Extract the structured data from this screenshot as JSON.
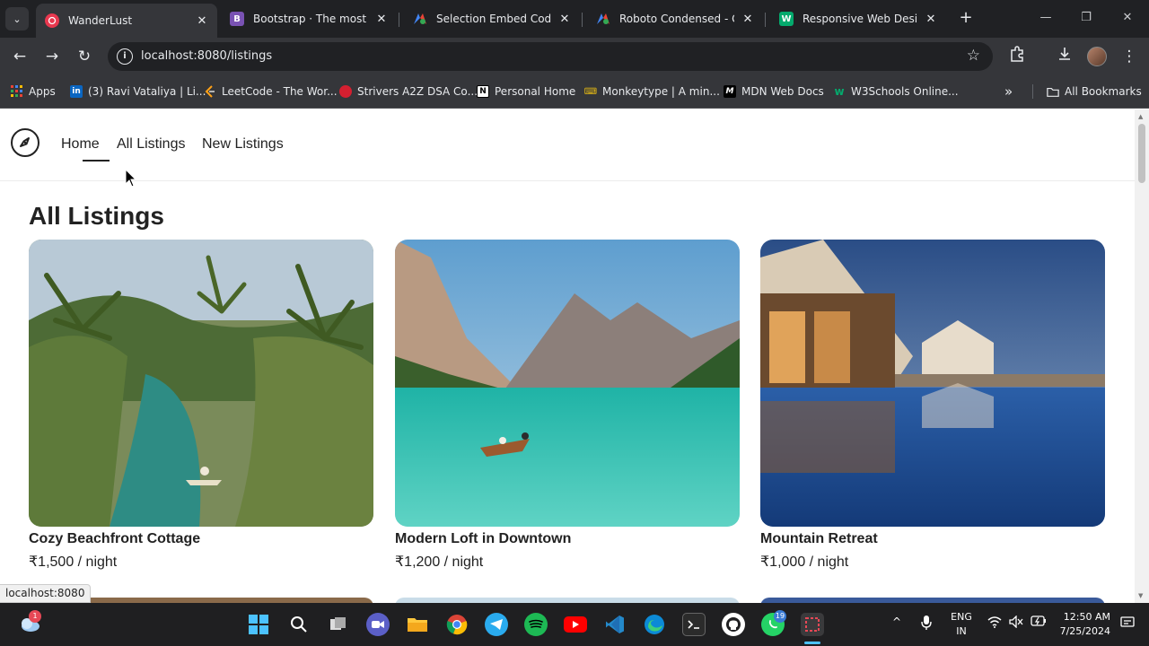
{
  "browser": {
    "tabs": [
      {
        "title": "WanderLust",
        "favicon_color": "#e8384f",
        "active": true
      },
      {
        "title": "Bootstrap · The most pop",
        "favicon_color": "#7952b3",
        "favicon_text": "B",
        "active": false
      },
      {
        "title": "Selection Embed Code - (",
        "favicon_color": "#4285f4",
        "active": false
      },
      {
        "title": "Roboto Condensed - Goo",
        "favicon_color": "#4285f4",
        "active": false
      },
      {
        "title": "Responsive Web Design (",
        "favicon_color": "#04aa6d",
        "favicon_text": "W",
        "active": false
      }
    ],
    "url": "localhost:8080/listings",
    "bookmarks": [
      {
        "label": "Apps",
        "icon": "apps-grid-icon",
        "color": "#4285f4"
      },
      {
        "label": "(3) Ravi Vataliya | Li...",
        "icon": "linkedin-icon",
        "color": "#0a66c2",
        "text": "in"
      },
      {
        "label": "LeetCode - The Wor...",
        "icon": "leetcode-icon",
        "color": "#ffa116"
      },
      {
        "label": "Strivers A2Z DSA Co...",
        "icon": "tuf-icon",
        "color": "#d41f30"
      },
      {
        "label": "Personal Home",
        "icon": "notion-icon",
        "color": "#ffffff",
        "text": "N"
      },
      {
        "label": "Monkeytype | A min...",
        "icon": "monkeytype-icon",
        "color": "#e2b714"
      },
      {
        "label": "MDN Web Docs",
        "icon": "mdn-icon",
        "color": "#000000",
        "text": "M"
      },
      {
        "label": "W3Schools Online...",
        "icon": "w3schools-icon",
        "color": "#04aa6d",
        "text": "w"
      }
    ],
    "all_bookmarks": "All Bookmarks",
    "overflow": "»",
    "status_url": "localhost:8080"
  },
  "nav": {
    "links": [
      {
        "label": "Home",
        "active": true
      },
      {
        "label": "All Listings",
        "active": false
      },
      {
        "label": "New Listings",
        "active": false
      }
    ]
  },
  "page_title": "All Listings",
  "listings": [
    {
      "name": "Cozy Beachfront Cottage",
      "price": "₹1,500 / night",
      "image": "tropical-river-palms"
    },
    {
      "name": "Modern Loft in Downtown",
      "price": "₹1,200 / night",
      "image": "mountain-lake-boat"
    },
    {
      "name": "Mountain Retreat",
      "price": "₹1,000 / night",
      "image": "resort-pool-night"
    }
  ],
  "taskbar": {
    "notification_badge": "1",
    "whatsapp_badge": "19",
    "language": [
      "ENG",
      "IN"
    ],
    "time": "12:50 AM",
    "date": "7/25/2024"
  }
}
